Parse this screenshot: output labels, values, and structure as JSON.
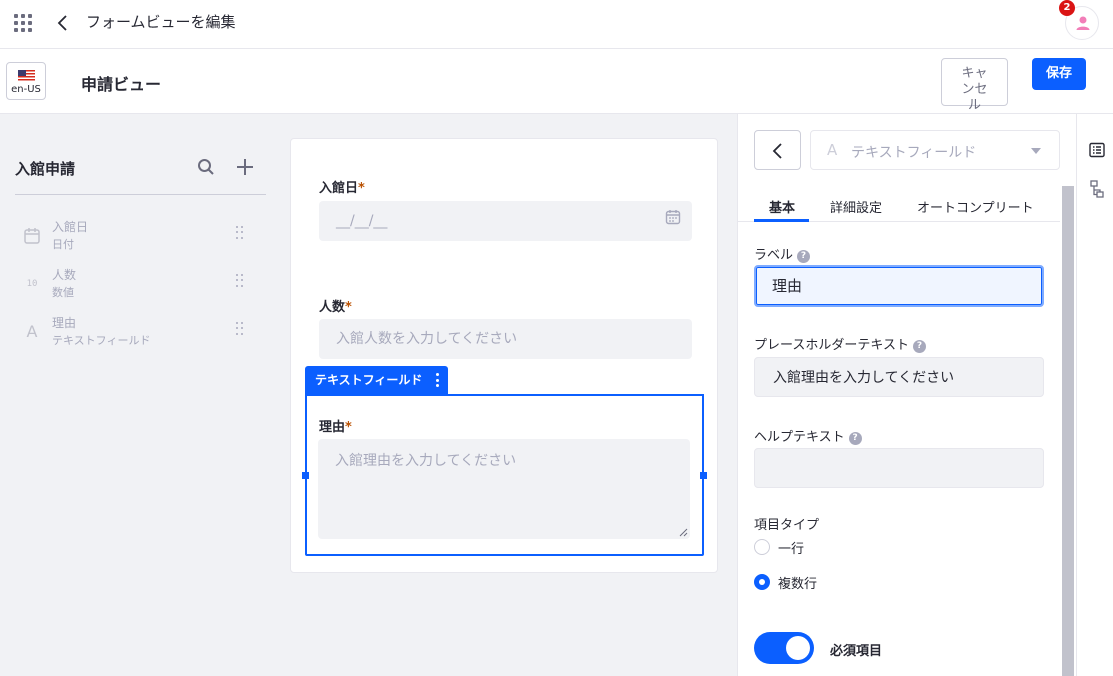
{
  "topbar": {
    "title": "フォームビューを編集",
    "notification_count": "2",
    "icons": [
      "apps-icon",
      "back-icon",
      "user-icon"
    ]
  },
  "subbar": {
    "locale": "en-US",
    "view_title": "申請ビュー",
    "cancel_label": "キャンセル",
    "save_label": "保存"
  },
  "sidebar": {
    "title": "入館申請",
    "fields": [
      {
        "name": "入館日",
        "type": "日付",
        "icon": "calendar-icon"
      },
      {
        "name": "人数",
        "type": "数値",
        "icon": "number-icon"
      },
      {
        "name": "理由",
        "type": "テキストフィールド",
        "icon": "text-icon"
      }
    ]
  },
  "canvas": {
    "date_field": {
      "label": "入館日",
      "placeholder": "__/__/__"
    },
    "count_field": {
      "label": "人数",
      "placeholder": "入館人数を入力してください"
    },
    "reason_field": {
      "label": "理由",
      "placeholder": "入館理由を入力してください"
    },
    "required_mark": "*",
    "selected_tag": "テキストフィールド"
  },
  "properties": {
    "field_type": "テキストフィールド",
    "tabs": [
      "基本",
      "詳細設定",
      "オートコンプリート"
    ],
    "active_tab": "基本",
    "label_title": "ラベル",
    "label_value": "理由",
    "placeholder_title": "プレースホルダーテキスト",
    "placeholder_value": "入館理由を入力してください",
    "help_title": "ヘルプテキスト",
    "help_value": "",
    "item_type_title": "項目タイプ",
    "item_type_options": [
      "一行",
      "複数行"
    ],
    "item_type_selected": "複数行",
    "required_title": "必須項目",
    "required_on": true,
    "help_glyph": "?"
  },
  "colors": {
    "primary": "#0b5fff",
    "required": "#b95000",
    "badge": "#da1414",
    "avatar": "#f27eb8"
  }
}
